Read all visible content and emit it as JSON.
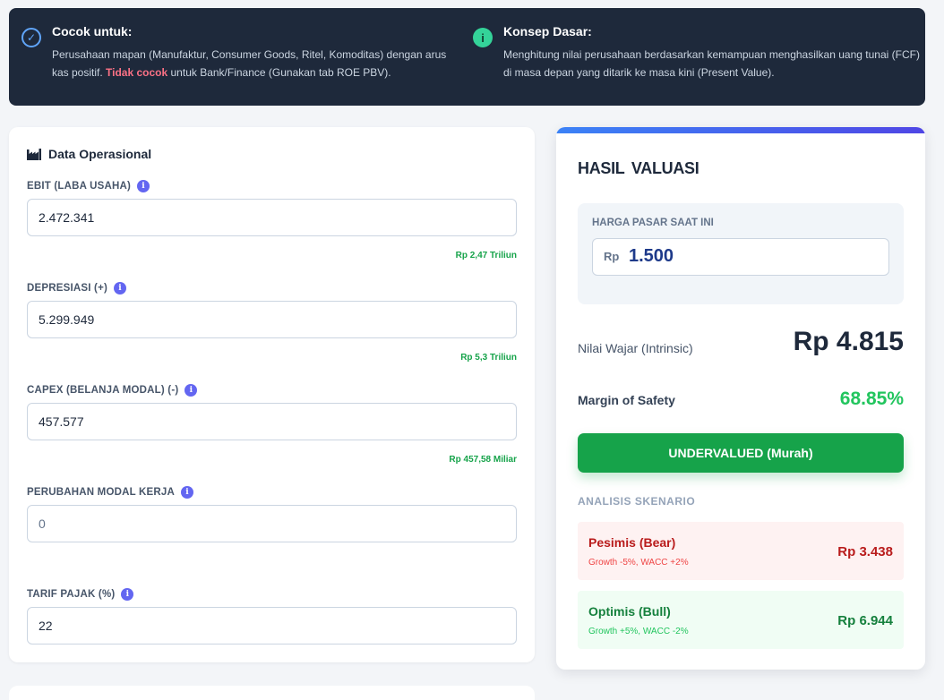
{
  "banner": {
    "left": {
      "icon": "check-circle-icon",
      "title": "Cocok untuk:",
      "text_before": "Perusahaan mapan (Manufaktur, Consumer Goods, Ritel, Komoditas) dengan arus kas positif. ",
      "warning": "Tidak cocok",
      "text_after": " untuk Bank/Finance (Gunakan tab ROE PBV)."
    },
    "right": {
      "icon": "info-icon",
      "title": "Konsep Dasar:",
      "text": "Menghitung nilai perusahaan berdasarkan kemampuan menghasilkan uang tunai (FCF) di masa depan yang ditarik ke masa kini (Present Value)."
    }
  },
  "operational": {
    "title": "Data Operasional",
    "icon": "factory-icon",
    "fields": [
      {
        "label": "EBIT (LABA USAHA)",
        "value": "2.472.341",
        "placeholder": "",
        "hint": "Rp 2,47 Triliun"
      },
      {
        "label": "DEPRESIASI (+)",
        "value": "5.299.949",
        "placeholder": "",
        "hint": "Rp 5,3 Triliun"
      },
      {
        "label": "CAPEX (BELANJA MODAL) (-)",
        "value": "457.577",
        "placeholder": "",
        "hint": "Rp 457,58 Miliar"
      },
      {
        "label": "PERUBAHAN MODAL KERJA",
        "value": "",
        "placeholder": "0",
        "hint": ""
      },
      {
        "label": "TARIF PAJAK (%)",
        "value": "22",
        "placeholder": "",
        "hint": ""
      }
    ]
  },
  "result": {
    "title": "HASIL VALUASI",
    "market_label": "HARGA PASAR SAAT INI",
    "market_prefix": "Rp",
    "market_value": "1.500",
    "intrinsic_label": "Nilai Wajar (Intrinsic)",
    "intrinsic_value": "Rp 4.815",
    "mos_label": "Margin of Safety",
    "mos_value": "68.85%",
    "status": "UNDERVALUED (Murah)",
    "scenario_heading": "ANALISIS SKENARIO",
    "scenarios": [
      {
        "name": "Pesimis (Bear)",
        "note": "Growth -5%, WACC +2%",
        "value": "Rp 3.438"
      },
      {
        "name": "Optimis (Bull)",
        "note": "Growth +5%, WACC -2%",
        "value": "Rp 6.944"
      }
    ]
  },
  "colors": {
    "banner_bg": "#1e293b",
    "accent_gradient_start": "#3b82f6",
    "accent_gradient_end": "#4f46e5",
    "success": "#16a34a",
    "danger": "#b91c1c",
    "market_value": "#1e3a8a"
  }
}
